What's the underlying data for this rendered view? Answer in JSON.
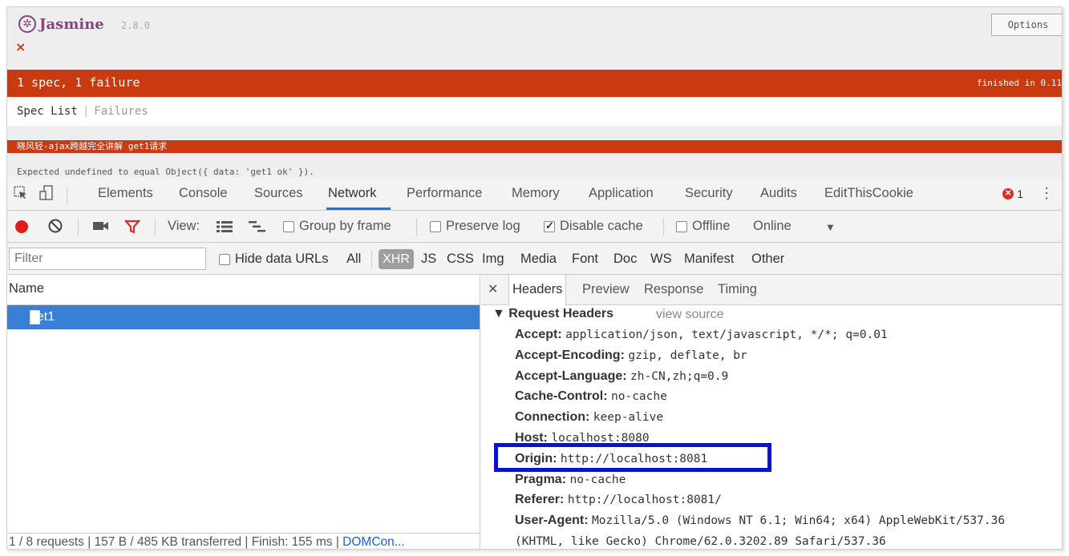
{
  "jasmine": {
    "logo_text": "Jasmine",
    "version": "2.8.0",
    "close_glyph": "×",
    "options_label": "Options",
    "summary": "1 spec, 1 failure",
    "duration": "finished in 0.11",
    "menu": {
      "spec_list": "Spec List",
      "separator": "|",
      "failures": "Failures"
    },
    "failed_spec": "晓风轻-ajax跨越完全讲解 get1请求",
    "failure_message": "Expected undefined to equal Object({ data: 'get1 ok' })."
  },
  "devtools": {
    "tabs": [
      "Elements",
      "Console",
      "Sources",
      "Network",
      "Performance",
      "Memory",
      "Application",
      "Security",
      "Audits",
      "EditThisCookie"
    ],
    "active_tab": "Network",
    "error_count": "1",
    "toolbar": {
      "view_label": "View:",
      "group_by_frame": "Group by frame",
      "preserve_log": "Preserve log",
      "disable_cache": "Disable cache",
      "offline": "Offline",
      "online": "Online"
    },
    "filter": {
      "placeholder": "Filter",
      "hide_data_urls": "Hide data URLs",
      "types": [
        "All",
        "XHR",
        "JS",
        "CSS",
        "Img",
        "Media",
        "Font",
        "Doc",
        "WS",
        "Manifest",
        "Other"
      ],
      "active_type": "XHR"
    },
    "requests": {
      "column_name": "Name",
      "items": [
        "get1"
      ],
      "status_text": "1 / 8 requests | 157 B / 485 KB transferred | Finish: 155 ms | ",
      "status_link": "DOMCon..."
    },
    "detail": {
      "tabs": [
        "Headers",
        "Preview",
        "Response",
        "Timing"
      ],
      "section_title": "▼ Request Headers",
      "view_source": "view source",
      "headers": [
        {
          "key": "Accept:",
          "value": "application/json, text/javascript, */*; q=0.01"
        },
        {
          "key": "Accept-Encoding:",
          "value": "gzip, deflate, br"
        },
        {
          "key": "Accept-Language:",
          "value": "zh-CN,zh;q=0.9"
        },
        {
          "key": "Cache-Control:",
          "value": "no-cache"
        },
        {
          "key": "Connection:",
          "value": "keep-alive"
        },
        {
          "key": "Host:",
          "value": "localhost:8080"
        },
        {
          "key": "Origin:",
          "value": "http://localhost:8081"
        },
        {
          "key": "Pragma:",
          "value": "no-cache"
        },
        {
          "key": "Referer:",
          "value": "http://localhost:8081/"
        },
        {
          "key": "User-Agent:",
          "value": "Mozilla/5.0 (Windows NT 6.1; Win64; x64) AppleWebKit/537.36"
        },
        {
          "key": "",
          "value": "(KHTML, like Gecko) Chrome/62.0.3202.89 Safari/537.36"
        }
      ]
    }
  },
  "colors": {
    "jasmine_red": "#ca3a11",
    "jasmine_purple": "#8a4182",
    "selection_blue": "#3a7fd6",
    "highlight_box": "#0a14d0",
    "record_red": "#e01d1d"
  },
  "icons": [
    "jasmine-logo-icon",
    "close-icon",
    "inspect-icon",
    "device-icon",
    "record-icon",
    "clear-icon",
    "camera-icon",
    "filter-icon",
    "large-rows-icon",
    "overview-icon",
    "error-icon",
    "kebab-menu-icon",
    "dropdown-icon",
    "file-icon"
  ]
}
